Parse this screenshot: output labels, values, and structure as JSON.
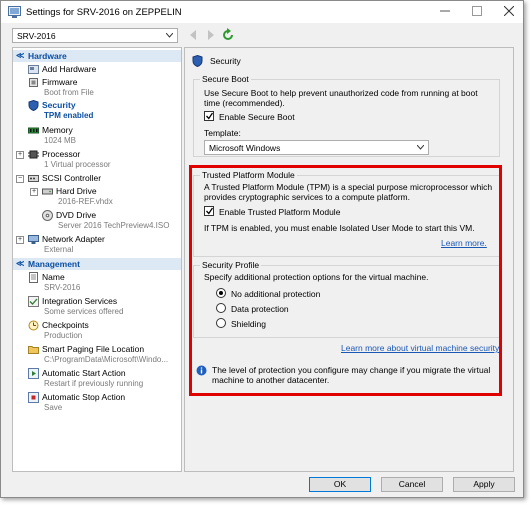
{
  "window": {
    "title": "Settings for SRV-2016 on ZEPPELIN"
  },
  "vm_selector": {
    "value": "SRV-2016"
  },
  "tree": {
    "hardware_header": "Hardware",
    "management_header": "Management",
    "hardware": [
      {
        "label": "Add Hardware",
        "sub": ""
      },
      {
        "label": "Firmware",
        "sub": "Boot from File"
      },
      {
        "label": "Security",
        "sub": "TPM enabled"
      },
      {
        "label": "Memory",
        "sub": "1024 MB"
      },
      {
        "label": "Processor",
        "sub": "1 Virtual processor"
      },
      {
        "label": "SCSI Controller",
        "sub": ""
      },
      {
        "label": "Hard Drive",
        "sub": "2016-REF.vhdx"
      },
      {
        "label": "DVD Drive",
        "sub": "Server 2016 TechPreview4.ISO"
      },
      {
        "label": "Network Adapter",
        "sub": "External"
      }
    ],
    "management": [
      {
        "label": "Name",
        "sub": "SRV-2016"
      },
      {
        "label": "Integration Services",
        "sub": "Some services offered"
      },
      {
        "label": "Checkpoints",
        "sub": "Production"
      },
      {
        "label": "Smart Paging File Location",
        "sub": "C:\\ProgramData\\Microsoft\\Windo..."
      },
      {
        "label": "Automatic Start Action",
        "sub": "Restart if previously running"
      },
      {
        "label": "Automatic Stop Action",
        "sub": "Save"
      }
    ]
  },
  "pane": {
    "title": "Security",
    "secure_boot": {
      "group_title": "Secure Boot",
      "description": "Use Secure Boot to help prevent unauthorized code from running at boot time (recommended).",
      "checkbox_label": "Enable Secure Boot",
      "checked": true,
      "template_label": "Template:",
      "template_value": "Microsoft Windows"
    },
    "tpm": {
      "group_title": "Trusted Platform Module",
      "description": "A Trusted Platform Module (TPM) is a special purpose microprocessor which provides cryptographic services to a compute platform.",
      "checkbox_label": "Enable Trusted Platform Module",
      "checked": true,
      "note": "If TPM is enabled, you must enable Isolated User Mode to start this VM.",
      "learn_more": "Learn more."
    },
    "security_profile": {
      "group_title": "Security Profile",
      "description": "Specify additional protection options for the virtual machine.",
      "options": [
        "No additional protection",
        "Data protection",
        "Shielding"
      ],
      "selected": "No additional protection",
      "link": "Learn more about virtual machine security."
    },
    "info_note": "The level of protection you configure may change if you migrate the virtual machine to another datacenter."
  },
  "buttons": {
    "ok": "OK",
    "cancel": "Cancel",
    "apply": "Apply"
  },
  "colors": {
    "accent": "#0b4ea2",
    "link": "#1a58b6",
    "highlight": "#e00000"
  }
}
